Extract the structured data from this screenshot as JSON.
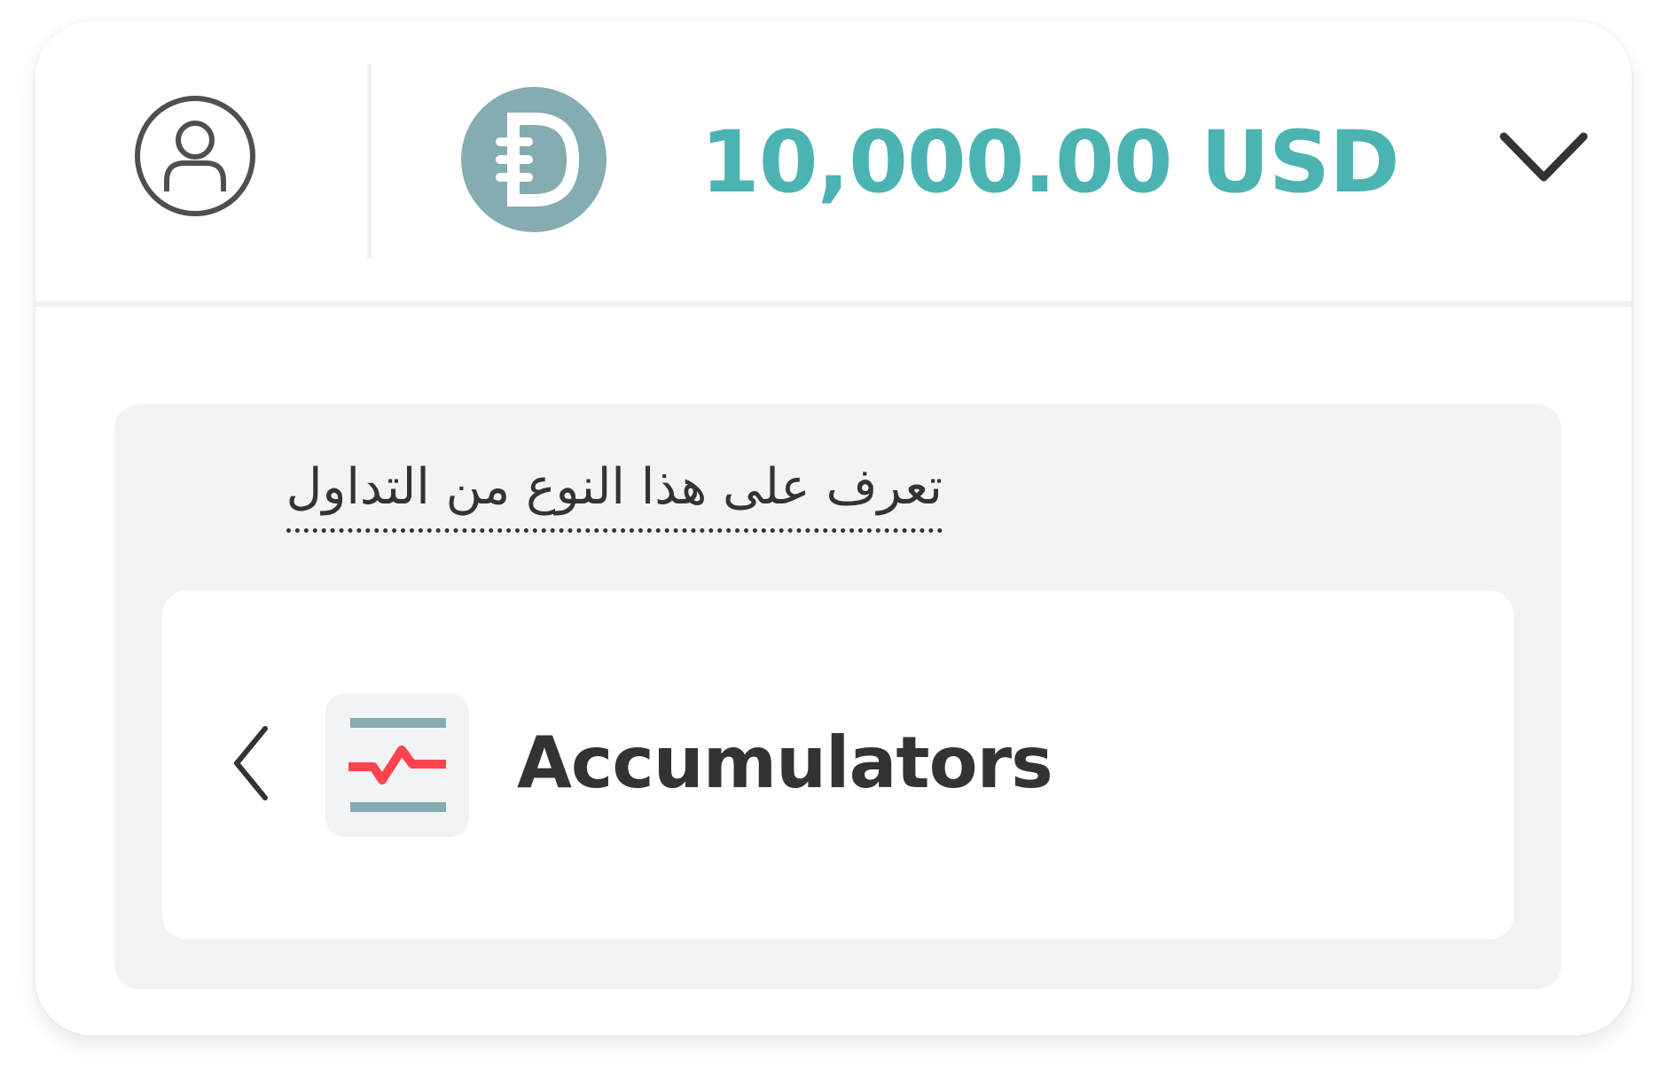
{
  "header": {
    "profile_icon": "user-circle-icon",
    "currency_icon": "deriv-demo-currency-icon",
    "balance": "10,000.00 USD",
    "dropdown_icon": "chevron-down-icon"
  },
  "info_panel": {
    "learn_link": "تعرف على هذا النوع من التداول",
    "trade_type": {
      "name": "Accumulators",
      "back_icon": "chevron-left-icon",
      "icon": "accumulators-icon"
    }
  },
  "colors": {
    "balance": "#4bb4b3",
    "currency_icon_bg": "#85acb0",
    "accent_red": "#ff444f",
    "text": "#333333",
    "panel_bg": "#f2f3f4"
  }
}
